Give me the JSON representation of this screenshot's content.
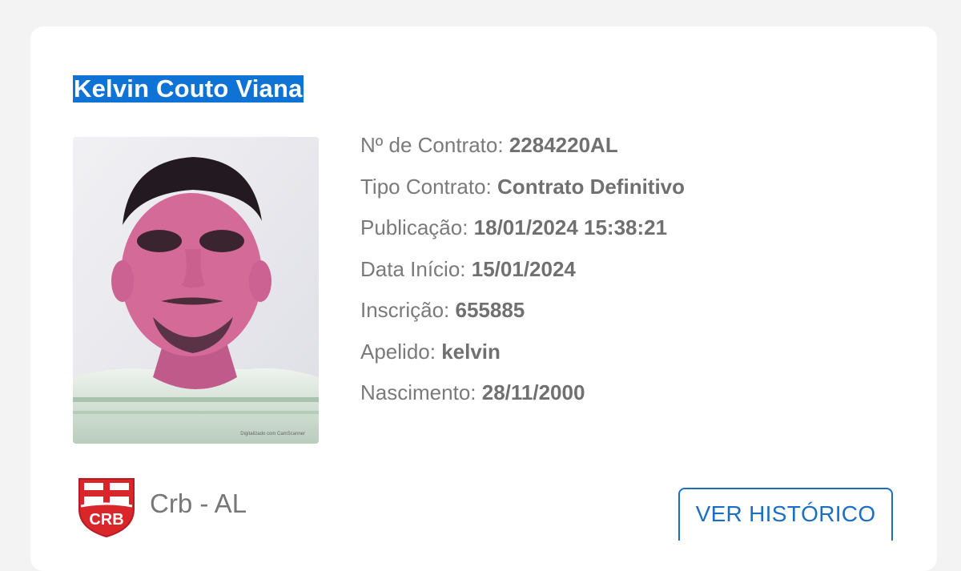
{
  "player": {
    "name": "Kelvin Couto Viana"
  },
  "contract": {
    "rows": [
      {
        "label": "Nº de Contrato:",
        "value": "2284220AL"
      },
      {
        "label": "Tipo Contrato:",
        "value": "Contrato Definitivo"
      },
      {
        "label": "Publicação:",
        "value": "18/01/2024 15:38:21"
      },
      {
        "label": "Data Início:",
        "value": "15/01/2024"
      },
      {
        "label": "Inscrição:",
        "value": "655885"
      },
      {
        "label": "Apelido:",
        "value": "kelvin"
      },
      {
        "label": "Nascimento:",
        "value": "28/11/2000"
      }
    ]
  },
  "club": {
    "name": "Crb - AL",
    "logo_icon": "crb-crest-icon",
    "logo_text": "CRB"
  },
  "photo": {
    "icon": "player-photo",
    "caption": "Digitalizado com CamScanner"
  },
  "actions": {
    "history_label": "VER HISTÓRICO"
  },
  "colors": {
    "name_highlight": "#0f73d6",
    "accent": "#1b6fc2",
    "club_red": "#d9262b"
  }
}
